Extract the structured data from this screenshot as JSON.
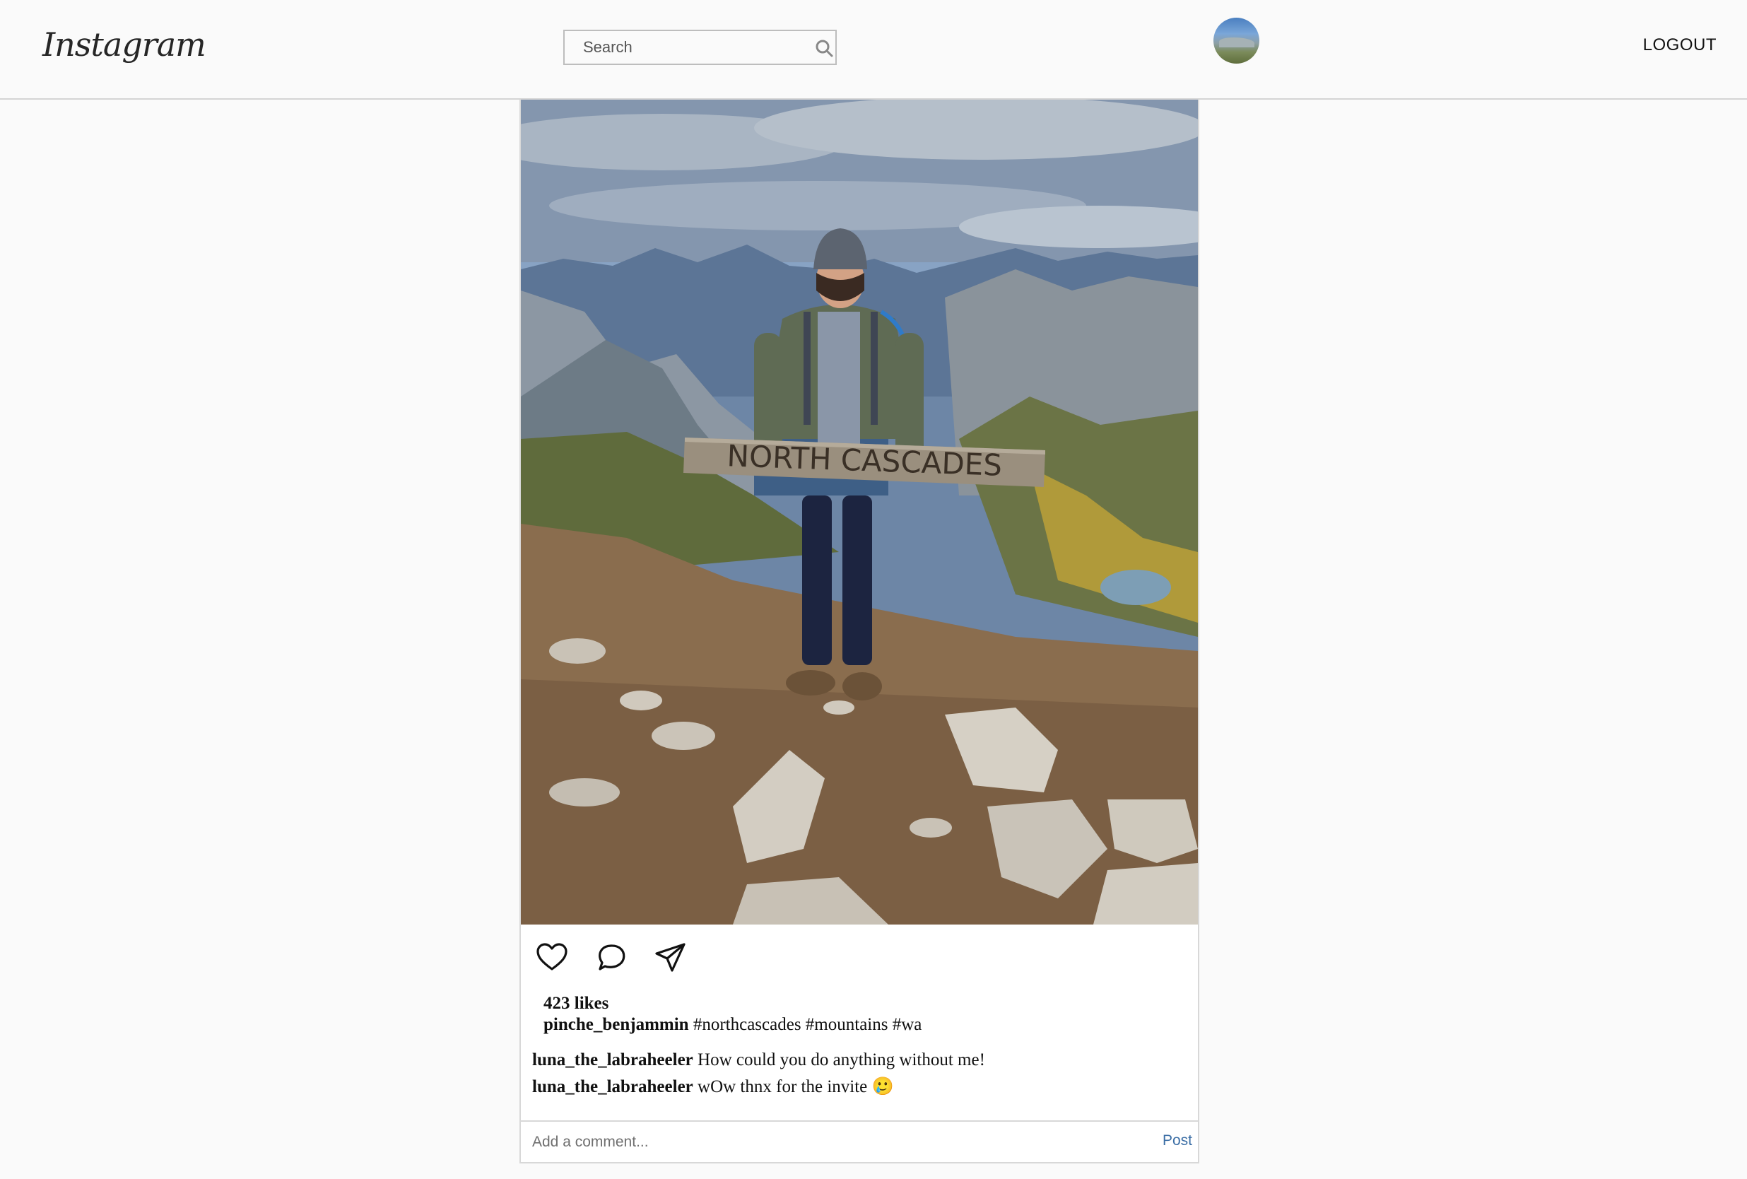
{
  "header": {
    "logo_text": "Instagram",
    "search_placeholder": "Search",
    "logout_label": "LOGOUT"
  },
  "post": {
    "image_sign_text": "NORTH CASCADES",
    "likes_text": "423 likes",
    "caption": {
      "username": "pinche_benjammin",
      "text": " #northcascades #mountains #wa"
    },
    "comments": [
      {
        "username": "luna_the_labraheeler",
        "text": " How could you do anything without me!"
      },
      {
        "username": "luna_the_labraheeler",
        "text": " wOw thnx for the invite 🥲"
      }
    ],
    "add_comment_placeholder": "Add a comment...",
    "post_button_label": "Post"
  },
  "icons": {
    "search": "search-icon",
    "like": "heart-icon",
    "comment": "speech-bubble-icon",
    "share": "paper-plane-icon"
  },
  "colors": {
    "background": "#fafafa",
    "border": "#d8d8d8",
    "post_link": "#3b6ea5"
  }
}
